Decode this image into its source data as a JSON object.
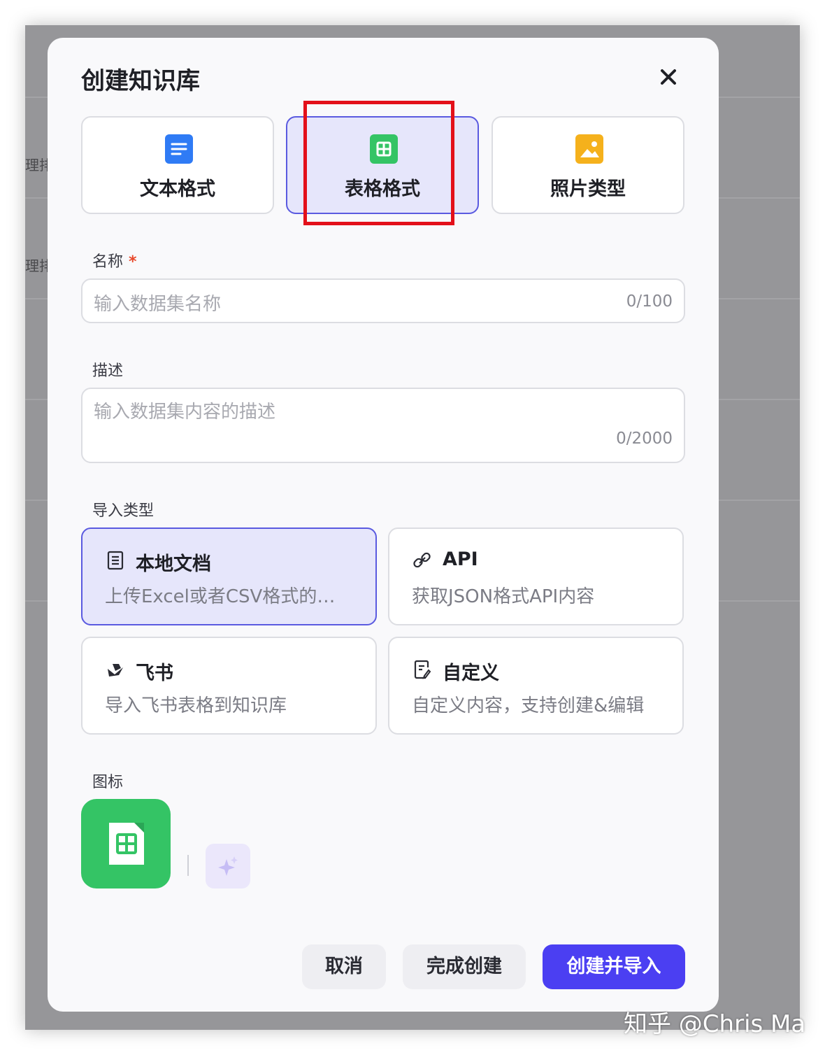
{
  "background": {
    "partial_text": [
      "理排",
      "理排"
    ]
  },
  "modal": {
    "title": "创建知识库"
  },
  "formats": [
    {
      "label": "文本格式",
      "icon": "text-doc-icon",
      "color": "#2f7bf5",
      "selected": false
    },
    {
      "label": "表格格式",
      "icon": "table-icon",
      "color": "#34c465",
      "selected": true
    },
    {
      "label": "照片类型",
      "icon": "image-icon",
      "color": "#f5b11c",
      "selected": false
    }
  ],
  "name_field": {
    "label": "名称",
    "required_mark": "*",
    "placeholder": "输入数据集名称",
    "counter": "0/100"
  },
  "desc_field": {
    "label": "描述",
    "placeholder": "输入数据集内容的描述",
    "counter": "0/2000"
  },
  "import": {
    "label": "导入类型",
    "types": [
      {
        "title": "本地文档",
        "desc": "上传Excel或者CSV格式的…",
        "icon": "document-icon",
        "selected": true
      },
      {
        "title": "API",
        "desc": "获取JSON格式API内容",
        "icon": "link-icon",
        "selected": false
      },
      {
        "title": "飞书",
        "desc": "导入飞书表格到知识库",
        "icon": "feishu-icon",
        "selected": false
      },
      {
        "title": "自定义",
        "desc": "自定义内容，支持创建&编辑",
        "icon": "edit-doc-icon",
        "selected": false
      }
    ]
  },
  "icon_section": {
    "label": "图标",
    "icon_color": "#34c465",
    "ai_icon": "sparkle-icon"
  },
  "buttons": {
    "cancel": "取消",
    "finish": "完成创建",
    "create_import": "创建并导入"
  },
  "watermark": "知乎 @Chris Ma"
}
